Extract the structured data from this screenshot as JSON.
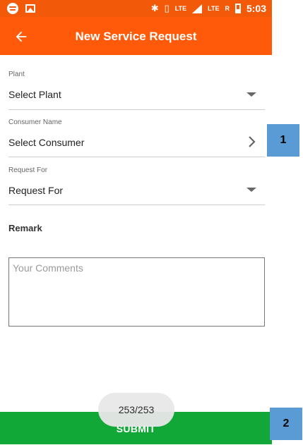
{
  "status_bar": {
    "time": "5:03",
    "lte_label_1": "LTE",
    "lte_label_2": "LTE",
    "roaming_label": "R"
  },
  "app_bar": {
    "title": "New Service Request"
  },
  "form": {
    "plant": {
      "label": "Plant",
      "value": "Select Plant"
    },
    "consumer": {
      "label": "Consumer Name",
      "value": "Select Consumer"
    },
    "request_for": {
      "label": "Request For",
      "value": "Request For"
    },
    "remark": {
      "label": "Remark",
      "placeholder": "Your Comments"
    }
  },
  "submit": {
    "label": "SUBMIT"
  },
  "toast": {
    "text": "253/253"
  },
  "callouts": [
    "1",
    "2"
  ],
  "colors": {
    "app_bar": "#ff5a0a",
    "submit": "#11a838",
    "callout": "#5b9bd5"
  }
}
